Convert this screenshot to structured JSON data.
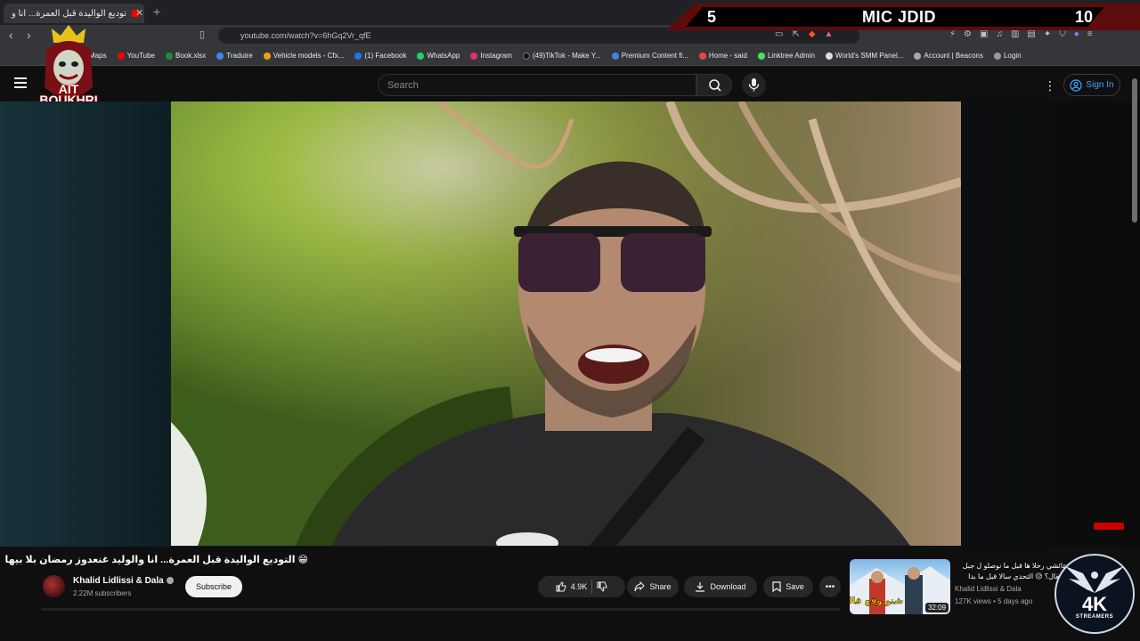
{
  "browser": {
    "tab_title": "توديع الواليدة قبل العمرة... انا و",
    "url": "youtube.com/watch?v=6hGq2Vr_qfE",
    "bookmarks": [
      "Maps",
      "YouTube",
      "Book.xlsx",
      "Traduire",
      "Vehicle models - Cfx...",
      "(1) Facebook",
      "WhatsApp",
      "Instagram",
      "(49)TikTok - Make Y...",
      "Premium Content fi...",
      "Home - said",
      "Linktree Admin",
      "World's SMM Panel...",
      "Account | Beacons",
      "Login"
    ]
  },
  "overlay": {
    "left_score": "5",
    "title": "MIC JDID",
    "right_score": "10",
    "logo_text": "AIT BOUKHRI",
    "corner_badge": "4K",
    "corner_badge_sub": "STREAMERS"
  },
  "youtube": {
    "search_placeholder": "Search",
    "sign_in": "Sign In",
    "video_title": "😁 التوديع الواليدة قبل العمرة... انا والوليد غنعدوز رمضان بلا بيها",
    "channel_name": "Khalid Lidlissi & Dala",
    "subscribers": "2.22M subscribers",
    "subscribe_label": "Subscribe",
    "likes": "4.9K",
    "share_label": "Share",
    "download_label": "Download",
    "save_label": "Save",
    "recommendation": {
      "title": "عائشي رحلا ها قبل ما نوصلو ل جبل توبقال؟ 😥 التحدي سالا قبل ما بدا",
      "channel": "Khalid Lidlissi & Dala",
      "meta": "127K views • 5 days ago",
      "duration": "32:09",
      "thumb_text": "شنو وقع فالطريق"
    }
  }
}
